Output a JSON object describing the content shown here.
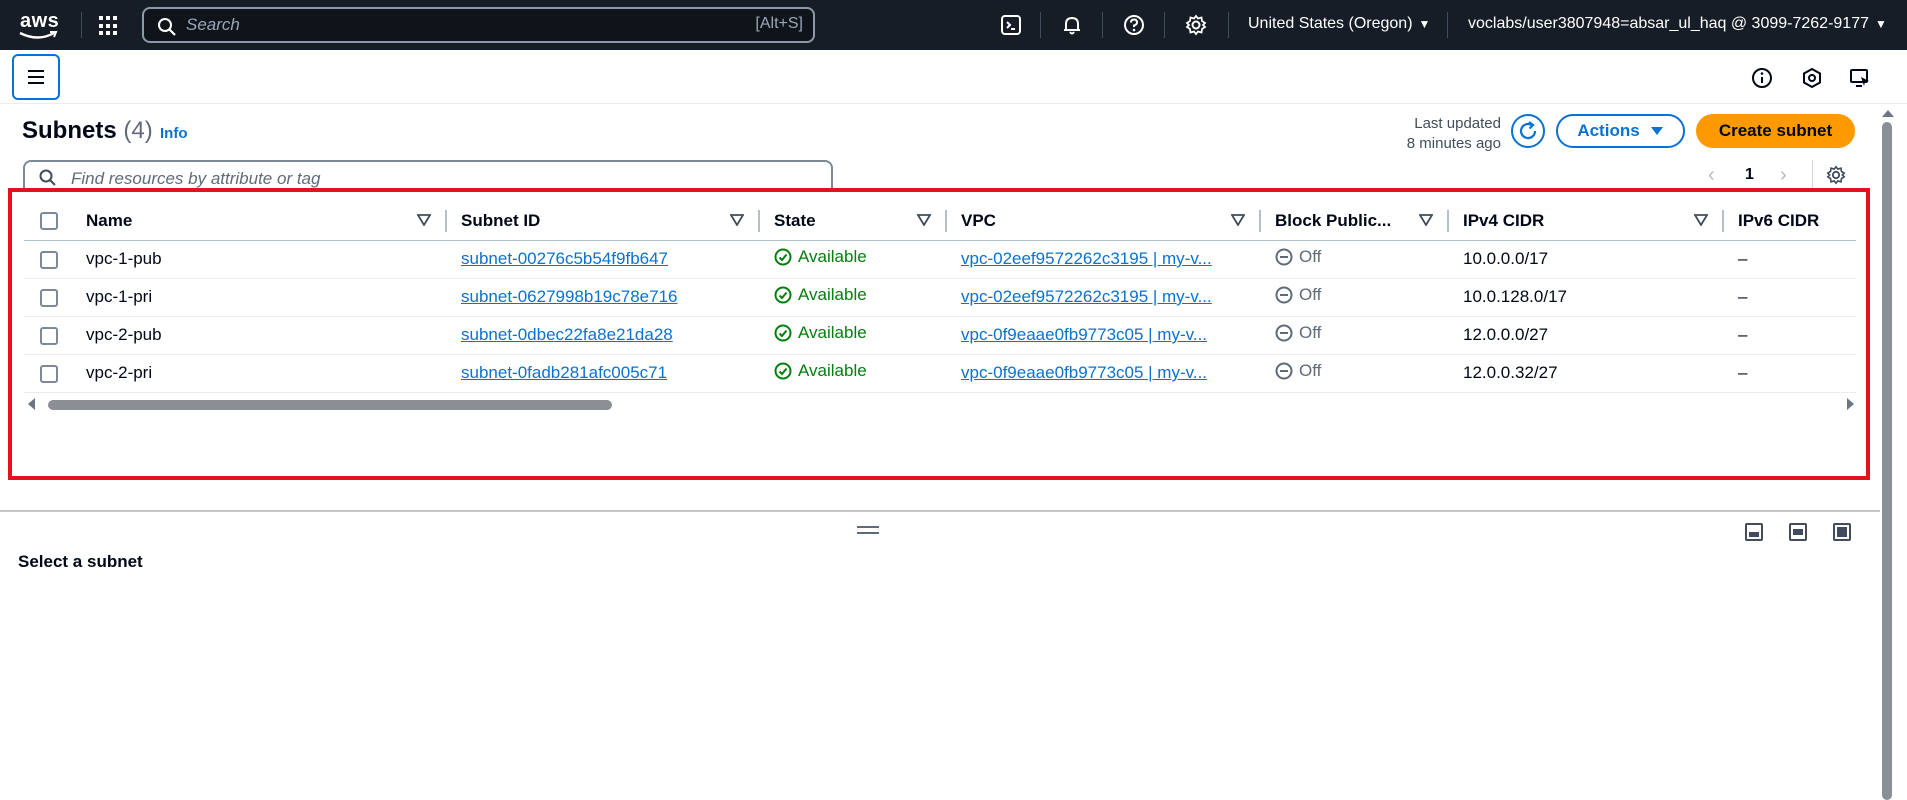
{
  "topnav": {
    "logo_text": "aws",
    "search_placeholder": "Search",
    "search_shortcut": "[Alt+S]",
    "icons": [
      "cloudshell-icon",
      "notifications-bell-icon",
      "help-icon",
      "settings-gear-icon"
    ],
    "region": "United States (Oregon)",
    "account": "voclabs/user3807948=absar_ul_haq @ 3099-7262-9177"
  },
  "header": {
    "title": "Subnets",
    "count": "(4)",
    "info": "Info",
    "last_updated_line1": "Last updated",
    "last_updated_line2": "8 minutes ago",
    "actions_label": "Actions",
    "create_label": "Create subnet"
  },
  "filter": {
    "placeholder": "Find resources by attribute or tag"
  },
  "pagination": {
    "current_page": "1"
  },
  "table": {
    "columns": [
      "Name",
      "Subnet ID",
      "State",
      "VPC",
      "Block Public...",
      "IPv4 CIDR",
      "IPv6 CIDR"
    ],
    "rows": [
      {
        "name": "vpc-1-pub",
        "subnet_id": "subnet-00276c5b54f9fb647",
        "state": "Available",
        "vpc": "vpc-02eef9572262c3195 | my-v...",
        "block_public": "Off",
        "ipv4": "10.0.0.0/17",
        "ipv6": "–"
      },
      {
        "name": "vpc-1-pri",
        "subnet_id": "subnet-0627998b19c78e716",
        "state": "Available",
        "vpc": "vpc-02eef9572262c3195 | my-v...",
        "block_public": "Off",
        "ipv4": "10.0.128.0/17",
        "ipv6": "–"
      },
      {
        "name": "vpc-2-pub",
        "subnet_id": "subnet-0dbec22fa8e21da28",
        "state": "Available",
        "vpc": "vpc-0f9eaae0fb9773c05 | my-v...",
        "block_public": "Off",
        "ipv4": "12.0.0.0/27",
        "ipv6": "–"
      },
      {
        "name": "vpc-2-pri",
        "subnet_id": "subnet-0fadb281afc005c71",
        "state": "Available",
        "vpc": "vpc-0f9eaae0fb9773c05 | my-v...",
        "block_public": "Off",
        "ipv4": "12.0.0.32/27",
        "ipv6": "–"
      }
    ]
  },
  "split_panel": {
    "empty_text": "Select a subnet"
  },
  "colors": {
    "nav_bg": "#161d26",
    "link": "#0972d3",
    "primary_button": "#ff9900",
    "success": "#037f0c",
    "highlight": "#e4111e"
  }
}
